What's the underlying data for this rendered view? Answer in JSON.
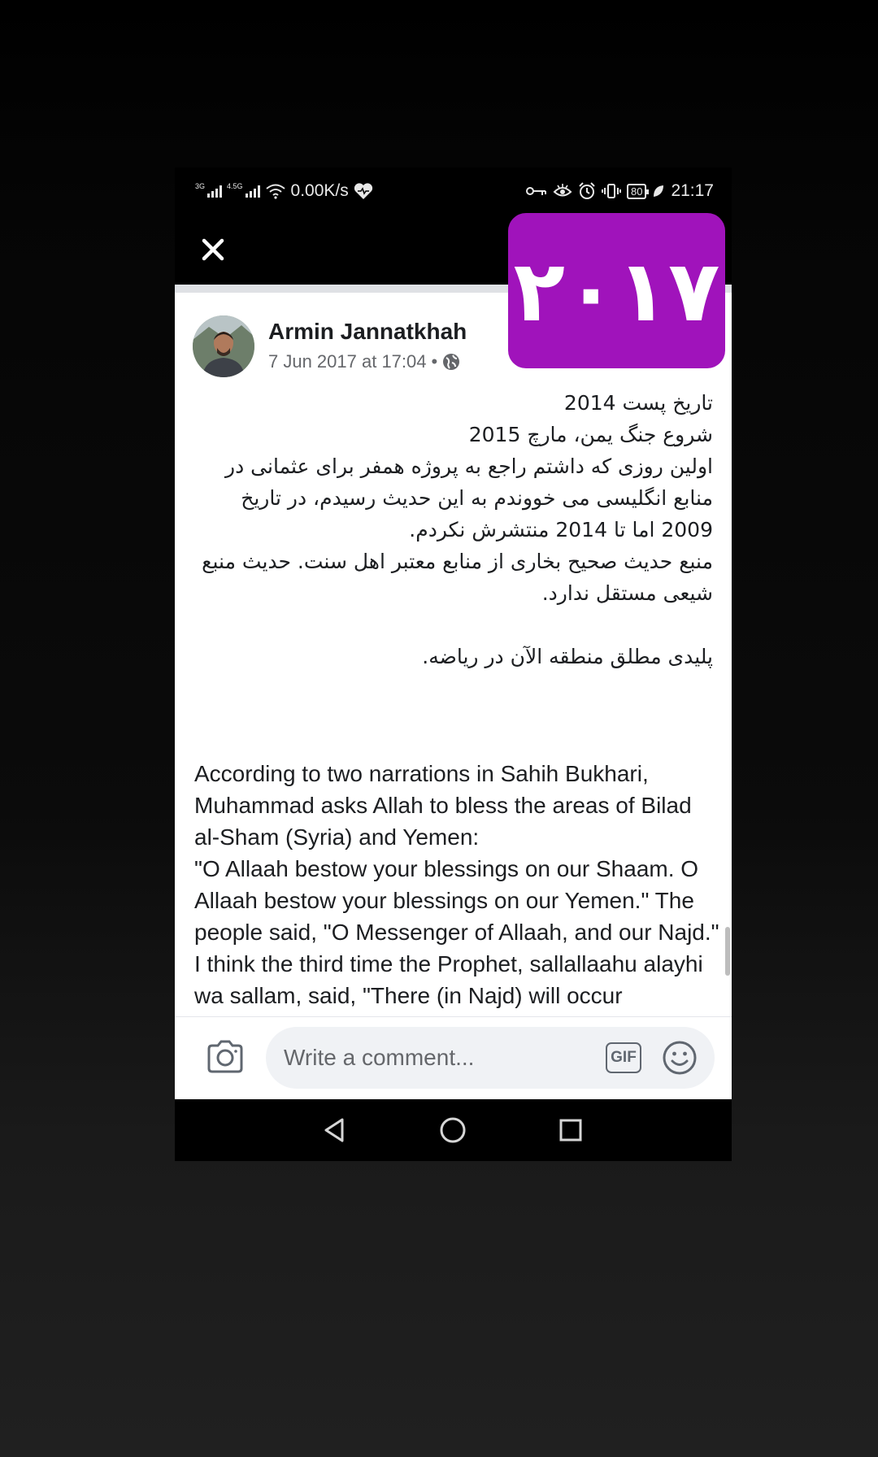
{
  "status_bar": {
    "net1": "3G",
    "net2": "4.5G",
    "speed": "0.00K/s",
    "battery": "80",
    "time": "21:17"
  },
  "overlay": {
    "year": "٢٠١٧",
    "badge_color": "#a013bb"
  },
  "post": {
    "author": "Armin Jannatkhah",
    "date": "7 Jun 2017 at 17:04",
    "separator": "•",
    "persian_lines": [
      "تاریخ پست 2014",
      "شروع جنگ یمن، مارچ 2015",
      "اولین روزی که داشتم راجع به پروژه همفر برای عثمانی در منابع انگلیسی می خووندم به این حدیث رسیدم، در تاریخ 2009 اما تا 2014 منتشرش نکردم.",
      "منبع حدیث صحیح بخاری از منابع معتبر اهل سنت. حدیث منبع شیعی مستقل ندارد.",
      "",
      "پلیدی مطلق منطقه الآن در ریاضه."
    ],
    "english_paragraphs": [
      "According to two narrations in Sahih Bukhari, Muhammad asks Allah to bless the areas of Bilad al-Sham (Syria) and Yemen:",
      "\"O Allaah bestow your blessings on our Shaam. O Allaah bestow your blessings on our Yemen.\" The people said, \"O Messenger of Allaah, and our Najd.\" I think the third time the Prophet, sallallaahu alayhi wa sallam, said, \"There (in Najd) will occur earthquakes, trials and"
    ]
  },
  "comment_bar": {
    "placeholder": "Write a comment...",
    "gif_label": "GIF"
  },
  "icons": {
    "close": "close-icon",
    "camera": "camera-icon",
    "emoji": "emoji-icon",
    "globe": "globe-icon",
    "back": "back-icon",
    "home": "home-icon",
    "recents": "recents-icon"
  }
}
